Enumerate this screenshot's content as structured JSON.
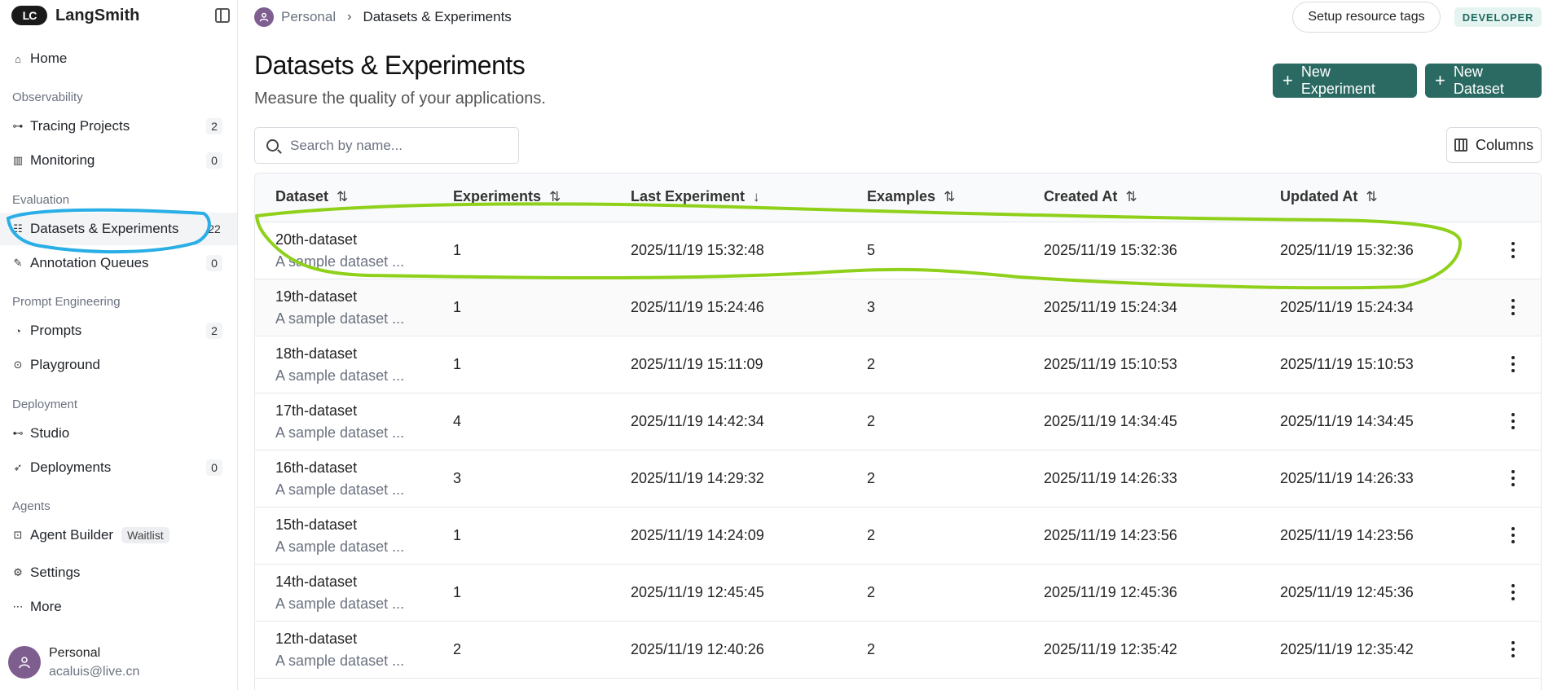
{
  "app": {
    "name": "LangSmith",
    "logo_mark": "LC"
  },
  "sidebar": {
    "items": [
      {
        "label": "Home",
        "icon": "home-icon",
        "badge": ""
      },
      {
        "label": "Tracing Projects",
        "icon": "tracing-icon",
        "badge": "2"
      },
      {
        "label": "Monitoring",
        "icon": "chart-icon",
        "badge": "0"
      },
      {
        "label": "Datasets & Experiments",
        "icon": "database-icon",
        "badge": "22"
      },
      {
        "label": "Annotation Queues",
        "icon": "pencil-icon",
        "badge": "0"
      },
      {
        "label": "Prompts",
        "icon": "prompt-icon",
        "badge": "2"
      },
      {
        "label": "Playground",
        "icon": "play-icon",
        "badge": ""
      },
      {
        "label": "Studio",
        "icon": "studio-icon",
        "badge": ""
      },
      {
        "label": "Deployments",
        "icon": "rocket-icon",
        "badge": "0"
      },
      {
        "label": "Agent Builder",
        "icon": "lock-icon",
        "badge": "",
        "pill": "Waitlist"
      },
      {
        "label": "Settings",
        "icon": "gear-icon",
        "badge": ""
      },
      {
        "label": "More",
        "icon": "ellipsis-icon",
        "badge": ""
      }
    ],
    "sections": [
      "Observability",
      "Evaluation",
      "Prompt Engineering",
      "Deployment",
      "Agents"
    ],
    "user": {
      "name": "Personal",
      "email": "acaluis@live.cn"
    }
  },
  "header": {
    "breadcrumb": {
      "workspace": "Personal",
      "current": "Datasets & Experiments"
    },
    "tags_button": "Setup resource tags",
    "plan_badge": "DEVELOPER"
  },
  "page": {
    "title": "Datasets & Experiments",
    "subtitle": "Measure the quality of your applications.",
    "new_experiment": "New Experiment",
    "new_dataset": "New Dataset",
    "search_placeholder": "Search by name...",
    "columns_button": "Columns"
  },
  "table": {
    "columns": [
      {
        "label": "Dataset",
        "sort": "⇅"
      },
      {
        "label": "Experiments",
        "sort": "⇅"
      },
      {
        "label": "Last Experiment",
        "sort": "↓"
      },
      {
        "label": "Examples",
        "sort": "⇅"
      },
      {
        "label": "Created At",
        "sort": "⇅"
      },
      {
        "label": "Updated At",
        "sort": "⇅"
      }
    ],
    "rows": [
      {
        "name": "20th-dataset",
        "desc": "A sample dataset ...",
        "experiments": "1",
        "last": "2025/11/19 15:32:48",
        "examples": "5",
        "created": "2025/11/19 15:32:36",
        "updated": "2025/11/19 15:32:36"
      },
      {
        "name": "19th-dataset",
        "desc": "A sample dataset ...",
        "experiments": "1",
        "last": "2025/11/19 15:24:46",
        "examples": "3",
        "created": "2025/11/19 15:24:34",
        "updated": "2025/11/19 15:24:34"
      },
      {
        "name": "18th-dataset",
        "desc": "A sample dataset ...",
        "experiments": "1",
        "last": "2025/11/19 15:11:09",
        "examples": "2",
        "created": "2025/11/19 15:10:53",
        "updated": "2025/11/19 15:10:53"
      },
      {
        "name": "17th-dataset",
        "desc": "A sample dataset ...",
        "experiments": "4",
        "last": "2025/11/19 14:42:34",
        "examples": "2",
        "created": "2025/11/19 14:34:45",
        "updated": "2025/11/19 14:34:45"
      },
      {
        "name": "16th-dataset",
        "desc": "A sample dataset ...",
        "experiments": "3",
        "last": "2025/11/19 14:29:32",
        "examples": "2",
        "created": "2025/11/19 14:26:33",
        "updated": "2025/11/19 14:26:33"
      },
      {
        "name": "15th-dataset",
        "desc": "A sample dataset ...",
        "experiments": "1",
        "last": "2025/11/19 14:24:09",
        "examples": "2",
        "created": "2025/11/19 14:23:56",
        "updated": "2025/11/19 14:23:56"
      },
      {
        "name": "14th-dataset",
        "desc": "A sample dataset ...",
        "experiments": "1",
        "last": "2025/11/19 12:45:45",
        "examples": "2",
        "created": "2025/11/19 12:45:36",
        "updated": "2025/11/19 12:45:36"
      },
      {
        "name": "12th-dataset",
        "desc": "A sample dataset ...",
        "experiments": "2",
        "last": "2025/11/19 12:40:26",
        "examples": "2",
        "created": "2025/11/19 12:35:42",
        "updated": "2025/11/19 12:35:42"
      }
    ]
  },
  "colors": {
    "primary": "#2b6a62",
    "annotation_blue": "#29aee6",
    "annotation_green": "#8fd11a"
  }
}
